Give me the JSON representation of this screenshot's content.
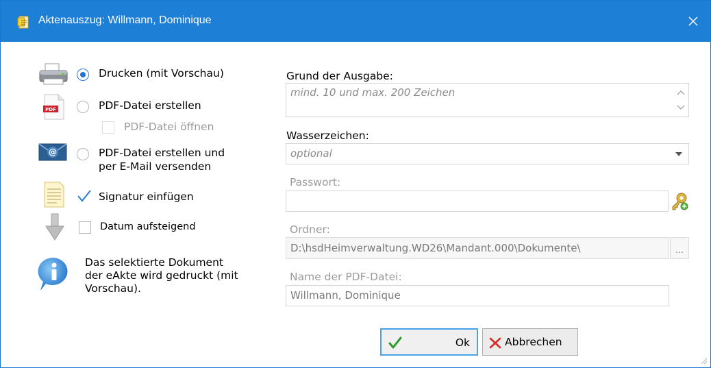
{
  "window": {
    "title": "Aktenauszug: Willmann, Dominique",
    "close_glyph": "✕",
    "accent": "#1e7fd6"
  },
  "options": {
    "print_label": "Drucken (mit Vorschau)",
    "print_selected": true,
    "pdf_label": "PDF-Datei erstellen",
    "pdf_open_label": "PDF-Datei öffnen",
    "email_label_line1": "PDF-Datei erstellen und",
    "email_label_line2": "per E-Mail versenden",
    "signature_label": "Signatur einfügen",
    "signature_checked": true,
    "date_label": "Datum aufsteigend",
    "date_checked": false
  },
  "info": {
    "line1": "Das selektierte Dokument",
    "line2": "der eAkte wird gedruckt (mit",
    "line3": "Vorschau)."
  },
  "form": {
    "reason_label": "Grund der Ausgabe:",
    "reason_placeholder": "mind. 10 und max. 200 Zeichen",
    "watermark_label": "Wasserzeichen:",
    "watermark_placeholder": "optional",
    "password_label": "Passwort:",
    "password_value": "",
    "folder_label": "Ordner:",
    "folder_value": "D:\\hsdHeimverwaltung.WD26\\Mandant.000\\Dokumente\\",
    "browse_label": "...",
    "filename_label": "Name der PDF-Datei:",
    "filename_value": "Willmann, Dominique"
  },
  "buttons": {
    "ok_label": "Ok",
    "cancel_label": "Abbrechen"
  },
  "icons": {
    "title": "document-icon",
    "printer": "printer-icon",
    "pdf": "pdf-icon",
    "email": "email-icon",
    "signature": "signature-icon",
    "date": "sort-down-icon",
    "info": "info-icon",
    "password": "key-icon",
    "ok": "check-icon",
    "cancel": "x-icon"
  },
  "pdf_icon_text": "PDF"
}
